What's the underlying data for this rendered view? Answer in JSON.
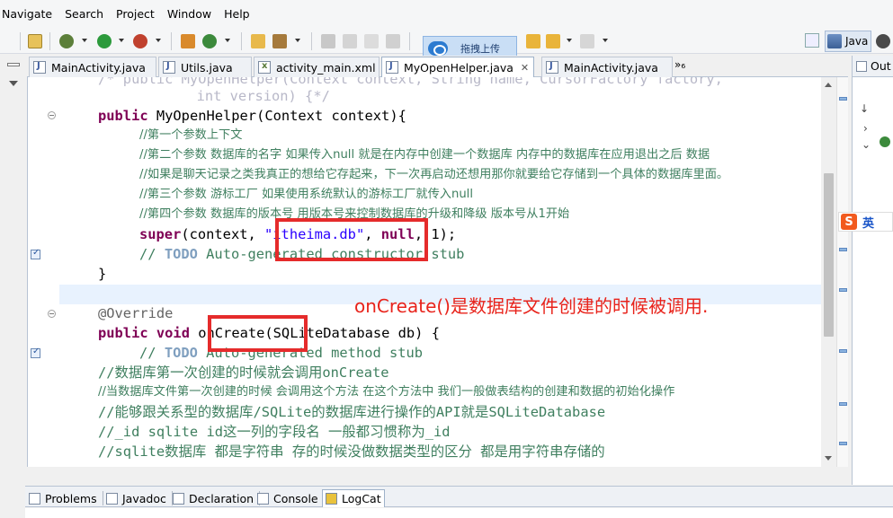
{
  "menu": {
    "items": [
      "Navigate",
      "Search",
      "Project",
      "Window",
      "Help"
    ]
  },
  "toolbar": {
    "upload_label": "拖拽上传",
    "perspective_label": "Java"
  },
  "tabs": [
    {
      "label": "MainActivity.java",
      "active": false
    },
    {
      "label": "Utils.java",
      "active": false
    },
    {
      "label": "activity_main.xml",
      "active": false
    },
    {
      "label": "MyOpenHelper.java",
      "active": true,
      "close": "✕"
    },
    {
      "label": "MainActivity.java",
      "active": false
    }
  ],
  "tab_overflow": "»₆",
  "outline": {
    "title": "Out"
  },
  "ime": {
    "logo": "S",
    "mode": "英"
  },
  "code": {
    "l0_ghost": "/* public MyOpenHelper(Context context, String name, CursorFactory factory,",
    "l1_ghost": "      int version) {*/",
    "l2_kw": "public",
    "l2_rest": " MyOpenHelper(Context context){",
    "l3": "//第一个参数上下文",
    "l4": "//第二个参数 数据库的名字 如果传入null 就是在内存中创建一个数据库 内存中的数据库在应用退出之后 数据",
    "l5": "//如果是聊天记录之类我真正的想给它存起来，下一次再启动还想用那你就要给它存储到一个具体的数据库里面。",
    "l6": "//第三个参数 游标工厂 如果使用系统默认的游标工厂就传入null",
    "l7": "//第四个参数 数据库的版本号 用版本号来控制数据库的升级和降级 版本号从1开始",
    "l8_kw": "super",
    "l8_a": "(context, ",
    "l8_str": "\"itheima.db\"",
    "l8_b": ", ",
    "l8_kw2": "null",
    "l8_c": ", 1);",
    "l9_a": "// ",
    "l9_todo": "TODO",
    "l9_b": " Auto-generated constructor stub",
    "l10": "}",
    "l12": "@Override",
    "l13_kw1": "public",
    "l13_kw2": "void",
    "l13_name": "onCreate",
    "l13_rest": "(SQLiteDatabase db) {",
    "l14_a": "// ",
    "l14_todo": "TODO",
    "l14_b": " Auto-generated method stub",
    "l15": "//数据库第一次创建的时候就会调用onCreate",
    "l16": "//当数据库文件第一次创建的时候 会调用这个方法 在这个方法中 我们一般做表结构的创建和数据的初始化操作",
    "l17": "//能够跟关系型的数据库/SQLite的数据库进行操作的API就是SQLiteDatabase",
    "l18": "//_id sqlite id这一列的字段名 一般都习惯称为_id",
    "l19": "//sqlite数据库 都是字符串 存的时候没做数据类型的区分 都是用字符串存储的"
  },
  "annotation": "onCreate()是数据库文件创建的时候被调用.",
  "bottom_tabs": [
    {
      "label": "Problems",
      "active": false
    },
    {
      "label": "Javadoc",
      "active": false
    },
    {
      "label": "Declaration",
      "active": false
    },
    {
      "label": "Console",
      "active": false
    },
    {
      "label": "LogCat",
      "active": true
    }
  ],
  "colors": {
    "keyword": "#7f0055",
    "string": "#2a00ff",
    "comment": "#3f7f5f",
    "todo": "#7f9fbf",
    "annotation_red": "#e52b2b"
  }
}
